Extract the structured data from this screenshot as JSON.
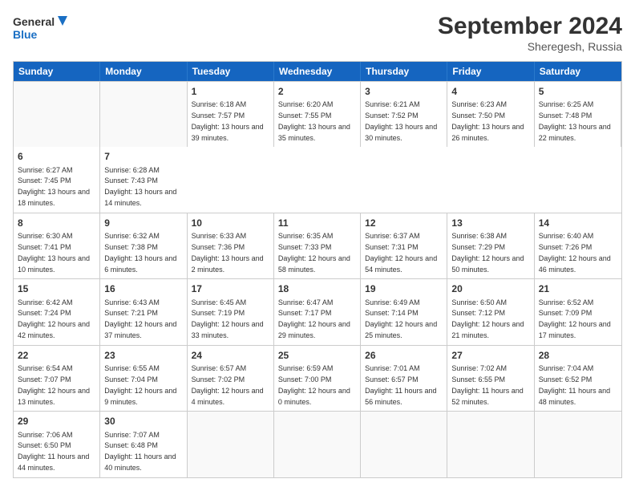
{
  "logo": {
    "line1": "General",
    "line2": "Blue"
  },
  "title": "September 2024",
  "subtitle": "Sheregesh, Russia",
  "days": [
    "Sunday",
    "Monday",
    "Tuesday",
    "Wednesday",
    "Thursday",
    "Friday",
    "Saturday"
  ],
  "rows": [
    [
      {
        "day": "",
        "empty": true
      },
      {
        "day": "1",
        "sunrise": "6:18 AM",
        "sunset": "7:57 PM",
        "daylight": "13 hours and 39 minutes."
      },
      {
        "day": "2",
        "sunrise": "6:20 AM",
        "sunset": "7:55 PM",
        "daylight": "13 hours and 35 minutes."
      },
      {
        "day": "3",
        "sunrise": "6:21 AM",
        "sunset": "7:52 PM",
        "daylight": "13 hours and 30 minutes."
      },
      {
        "day": "4",
        "sunrise": "6:23 AM",
        "sunset": "7:50 PM",
        "daylight": "13 hours and 26 minutes."
      },
      {
        "day": "5",
        "sunrise": "6:25 AM",
        "sunset": "7:48 PM",
        "daylight": "13 hours and 22 minutes."
      },
      {
        "day": "6",
        "sunrise": "6:27 AM",
        "sunset": "7:45 PM",
        "daylight": "13 hours and 18 minutes."
      },
      {
        "day": "7",
        "sunrise": "6:28 AM",
        "sunset": "7:43 PM",
        "daylight": "13 hours and 14 minutes."
      }
    ],
    [
      {
        "day": "8",
        "sunrise": "6:30 AM",
        "sunset": "7:41 PM",
        "daylight": "13 hours and 10 minutes."
      },
      {
        "day": "9",
        "sunrise": "6:32 AM",
        "sunset": "7:38 PM",
        "daylight": "13 hours and 6 minutes."
      },
      {
        "day": "10",
        "sunrise": "6:33 AM",
        "sunset": "7:36 PM",
        "daylight": "13 hours and 2 minutes."
      },
      {
        "day": "11",
        "sunrise": "6:35 AM",
        "sunset": "7:33 PM",
        "daylight": "12 hours and 58 minutes."
      },
      {
        "day": "12",
        "sunrise": "6:37 AM",
        "sunset": "7:31 PM",
        "daylight": "12 hours and 54 minutes."
      },
      {
        "day": "13",
        "sunrise": "6:38 AM",
        "sunset": "7:29 PM",
        "daylight": "12 hours and 50 minutes."
      },
      {
        "day": "14",
        "sunrise": "6:40 AM",
        "sunset": "7:26 PM",
        "daylight": "12 hours and 46 minutes."
      }
    ],
    [
      {
        "day": "15",
        "sunrise": "6:42 AM",
        "sunset": "7:24 PM",
        "daylight": "12 hours and 42 minutes."
      },
      {
        "day": "16",
        "sunrise": "6:43 AM",
        "sunset": "7:21 PM",
        "daylight": "12 hours and 37 minutes."
      },
      {
        "day": "17",
        "sunrise": "6:45 AM",
        "sunset": "7:19 PM",
        "daylight": "12 hours and 33 minutes."
      },
      {
        "day": "18",
        "sunrise": "6:47 AM",
        "sunset": "7:17 PM",
        "daylight": "12 hours and 29 minutes."
      },
      {
        "day": "19",
        "sunrise": "6:49 AM",
        "sunset": "7:14 PM",
        "daylight": "12 hours and 25 minutes."
      },
      {
        "day": "20",
        "sunrise": "6:50 AM",
        "sunset": "7:12 PM",
        "daylight": "12 hours and 21 minutes."
      },
      {
        "day": "21",
        "sunrise": "6:52 AM",
        "sunset": "7:09 PM",
        "daylight": "12 hours and 17 minutes."
      }
    ],
    [
      {
        "day": "22",
        "sunrise": "6:54 AM",
        "sunset": "7:07 PM",
        "daylight": "12 hours and 13 minutes."
      },
      {
        "day": "23",
        "sunrise": "6:55 AM",
        "sunset": "7:04 PM",
        "daylight": "12 hours and 9 minutes."
      },
      {
        "day": "24",
        "sunrise": "6:57 AM",
        "sunset": "7:02 PM",
        "daylight": "12 hours and 4 minutes."
      },
      {
        "day": "25",
        "sunrise": "6:59 AM",
        "sunset": "7:00 PM",
        "daylight": "12 hours and 0 minutes."
      },
      {
        "day": "26",
        "sunrise": "7:01 AM",
        "sunset": "6:57 PM",
        "daylight": "11 hours and 56 minutes."
      },
      {
        "day": "27",
        "sunrise": "7:02 AM",
        "sunset": "6:55 PM",
        "daylight": "11 hours and 52 minutes."
      },
      {
        "day": "28",
        "sunrise": "7:04 AM",
        "sunset": "6:52 PM",
        "daylight": "11 hours and 48 minutes."
      }
    ],
    [
      {
        "day": "29",
        "sunrise": "7:06 AM",
        "sunset": "6:50 PM",
        "daylight": "11 hours and 44 minutes."
      },
      {
        "day": "30",
        "sunrise": "7:07 AM",
        "sunset": "6:48 PM",
        "daylight": "11 hours and 40 minutes."
      },
      {
        "day": "",
        "empty": true
      },
      {
        "day": "",
        "empty": true
      },
      {
        "day": "",
        "empty": true
      },
      {
        "day": "",
        "empty": true
      },
      {
        "day": "",
        "empty": true
      }
    ]
  ]
}
